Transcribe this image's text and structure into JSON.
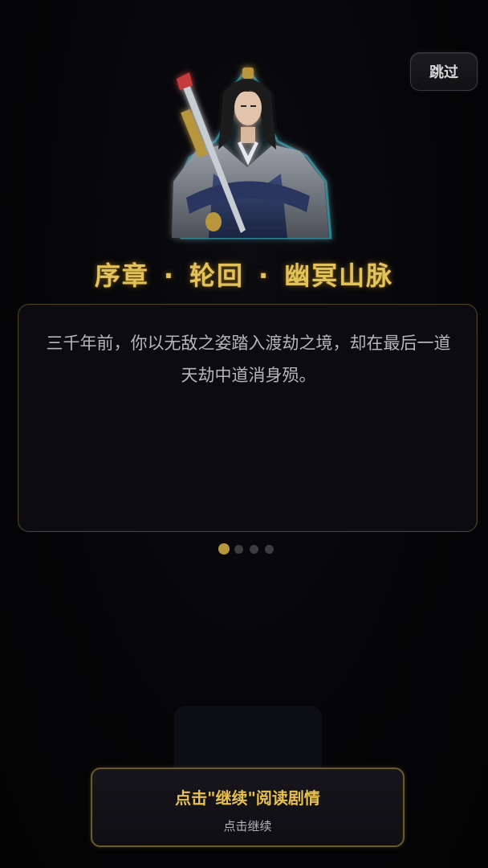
{
  "skip_label": "跳过",
  "chapter": {
    "part1": "序章",
    "part2": "轮回",
    "part3": "幽冥山脉",
    "separator": "·"
  },
  "story": {
    "text": "三千年前，你以无敌之姿踏入渡劫之境，却在最后一道天劫中道消身殒。"
  },
  "pagination": {
    "current": 1,
    "total": 4
  },
  "continue_button": {
    "main_label": "点击\"继续\"阅读剧情",
    "sub_label": "点击继续"
  },
  "colors": {
    "title_gold": "#e2c25a",
    "button_gold": "#e8c04c",
    "border_gold": "#6b5a2c",
    "dot_active": "#b8963c",
    "portrait_glow": "#3fb8c8"
  },
  "icons": {
    "portrait": "swordsman-portrait"
  }
}
